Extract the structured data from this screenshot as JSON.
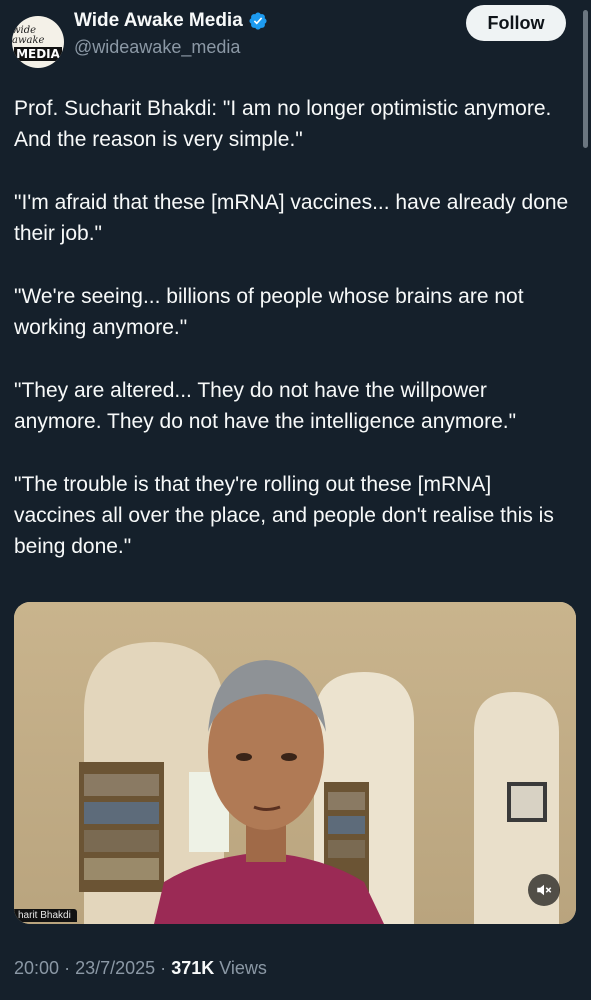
{
  "author": {
    "display_name": "Wide Awake Media",
    "handle": "@wideawake_media",
    "avatar_logo_top": "wide awake",
    "avatar_logo_bottom": "MEDIA",
    "verified": true
  },
  "follow_label": "Follow",
  "tweet": {
    "paragraphs": [
      "Prof. Sucharit Bhakdi: \"I am no longer optimistic anymore. And the reason is very simple.\"",
      "\"I'm afraid that these [mRNA] vaccines... have already done their job.\"",
      "\"We're seeing... billions of people whose brains are not working anymore.\"",
      "\"They are altered... They do not have the willpower anymore. They do not have the intelligence anymore.\"",
      "\"The trouble is that they're rolling out these [mRNA] vaccines all over the place, and people don't realise this is being done.\""
    ]
  },
  "media": {
    "caption_label": "harit Bhakdi",
    "mute_icon": "speaker-muted-icon"
  },
  "meta": {
    "time": "20:00",
    "separator": "·",
    "date": "23/7/2025",
    "views_count": "371K",
    "views_label": "Views"
  },
  "colors": {
    "background": "#15202b",
    "text": "#f7f9f9",
    "secondary": "#8b98a5",
    "verified": "#1d9bf0"
  }
}
